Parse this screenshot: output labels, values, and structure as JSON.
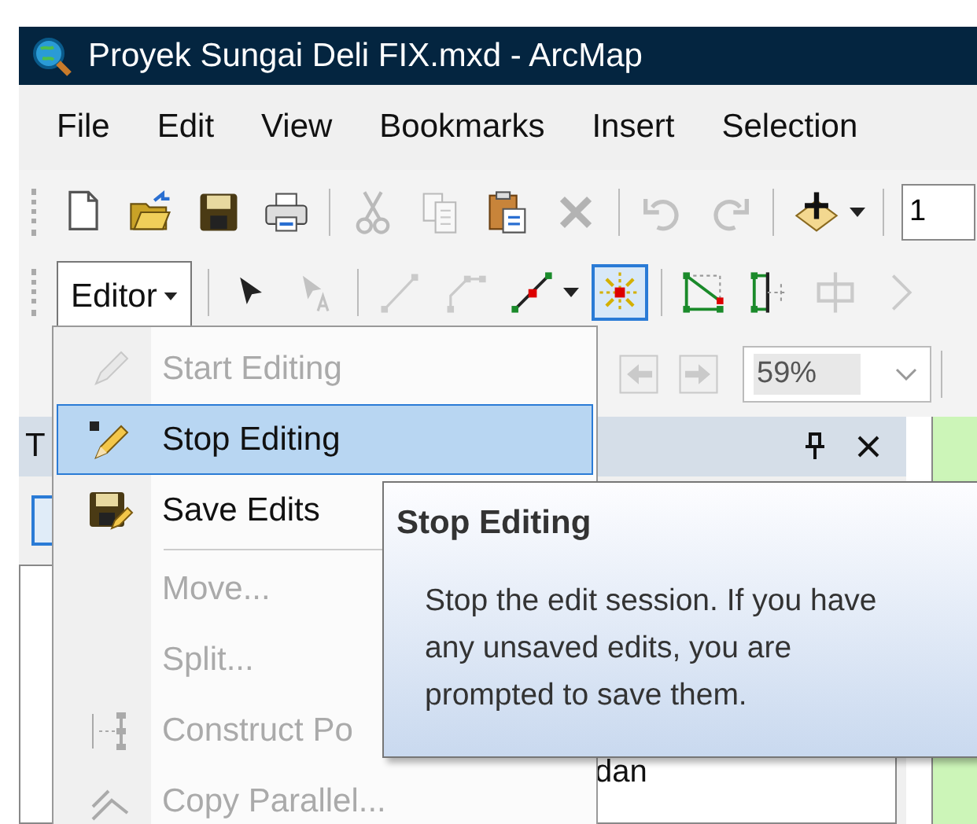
{
  "window": {
    "title": "Proyek Sungai Deli FIX.mxd - ArcMap"
  },
  "menu_bar": [
    "File",
    "Edit",
    "View",
    "Bookmarks",
    "Insert",
    "Selection"
  ],
  "standard_toolbar": [
    [
      {
        "kind": "new",
        "disabled": false
      },
      {
        "kind": "open",
        "disabled": false
      },
      {
        "kind": "save",
        "disabled": false
      },
      {
        "kind": "print",
        "disabled": false
      }
    ],
    [
      {
        "kind": "cut",
        "disabled": true
      },
      {
        "kind": "copy",
        "disabled": true
      },
      {
        "kind": "paste",
        "disabled": false
      },
      {
        "kind": "delete",
        "disabled": true
      }
    ],
    [
      {
        "kind": "undo",
        "disabled": true
      },
      {
        "kind": "redo",
        "disabled": true
      }
    ],
    [
      {
        "kind": "add",
        "disabled": false
      }
    ]
  ],
  "scale_field": {
    "value": "1"
  },
  "editor_toolbar": {
    "label": "Editor",
    "tools": [
      [
        {
          "kind": "arrow",
          "disabled": false,
          "selected": false
        },
        {
          "kind": "annotation",
          "disabled": true,
          "selected": false
        }
      ],
      [
        {
          "kind": "line",
          "disabled": true,
          "selected": false
        },
        {
          "kind": "arc",
          "disabled": true,
          "selected": false
        },
        {
          "kind": "sketch",
          "disabled": false,
          "selected": false
        },
        {
          "kind": "snap",
          "disabled": false,
          "selected": true
        }
      ],
      [
        {
          "kind": "triangle",
          "disabled": false,
          "selected": false
        },
        {
          "kind": "edge",
          "disabled": false,
          "selected": false
        },
        {
          "kind": "box",
          "disabled": true,
          "selected": false
        },
        {
          "kind": "chevron",
          "disabled": true,
          "selected": false
        }
      ]
    ]
  },
  "zoom_combo": {
    "value": "59%"
  },
  "panel": {
    "title": "T"
  },
  "tree": {
    "items": [
      {
        "label": "dan"
      }
    ]
  },
  "editor_menu": [
    {
      "kind": "command",
      "label": "Start Editing",
      "disabled": true,
      "selected": false
    },
    {
      "kind": "command",
      "label": "Stop Editing",
      "disabled": false,
      "selected": true
    },
    {
      "kind": "command",
      "label": "Save Edits",
      "disabled": false,
      "selected": false
    },
    {
      "kind": "separator"
    },
    {
      "kind": "command",
      "label": "Move...",
      "disabled": true,
      "selected": false
    },
    {
      "kind": "command",
      "label": "Split...",
      "disabled": true,
      "selected": false
    },
    {
      "kind": "command",
      "label": "Construct Po",
      "disabled": true,
      "selected": false
    },
    {
      "kind": "command",
      "label": "Copy Parallel...",
      "disabled": true,
      "selected": false
    }
  ],
  "tooltip": {
    "title": "Stop Editing",
    "lines": [
      "Stop the edit session. If you have",
      "any unsaved edits, you are",
      "prompted to save them."
    ]
  }
}
